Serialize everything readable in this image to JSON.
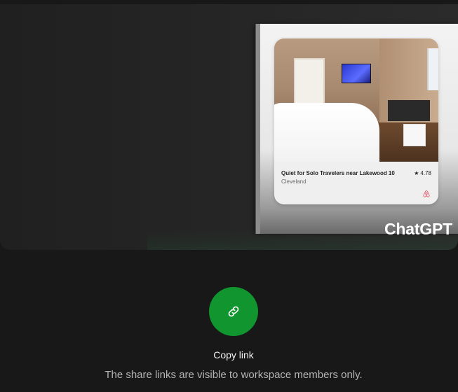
{
  "preview": {
    "listing": {
      "title": "Quiet for Solo Travelers near Lakewood 10",
      "city": "Cleveland",
      "rating": "4.78",
      "star_icon": "star-icon",
      "logo_icon": "airbnb-logo-icon"
    },
    "brand": "ChatGPT"
  },
  "share": {
    "copy_icon": "link-icon",
    "copy_label": "Copy link",
    "note": "The share links are visible to workspace members only.",
    "button_color": "#11962f"
  }
}
